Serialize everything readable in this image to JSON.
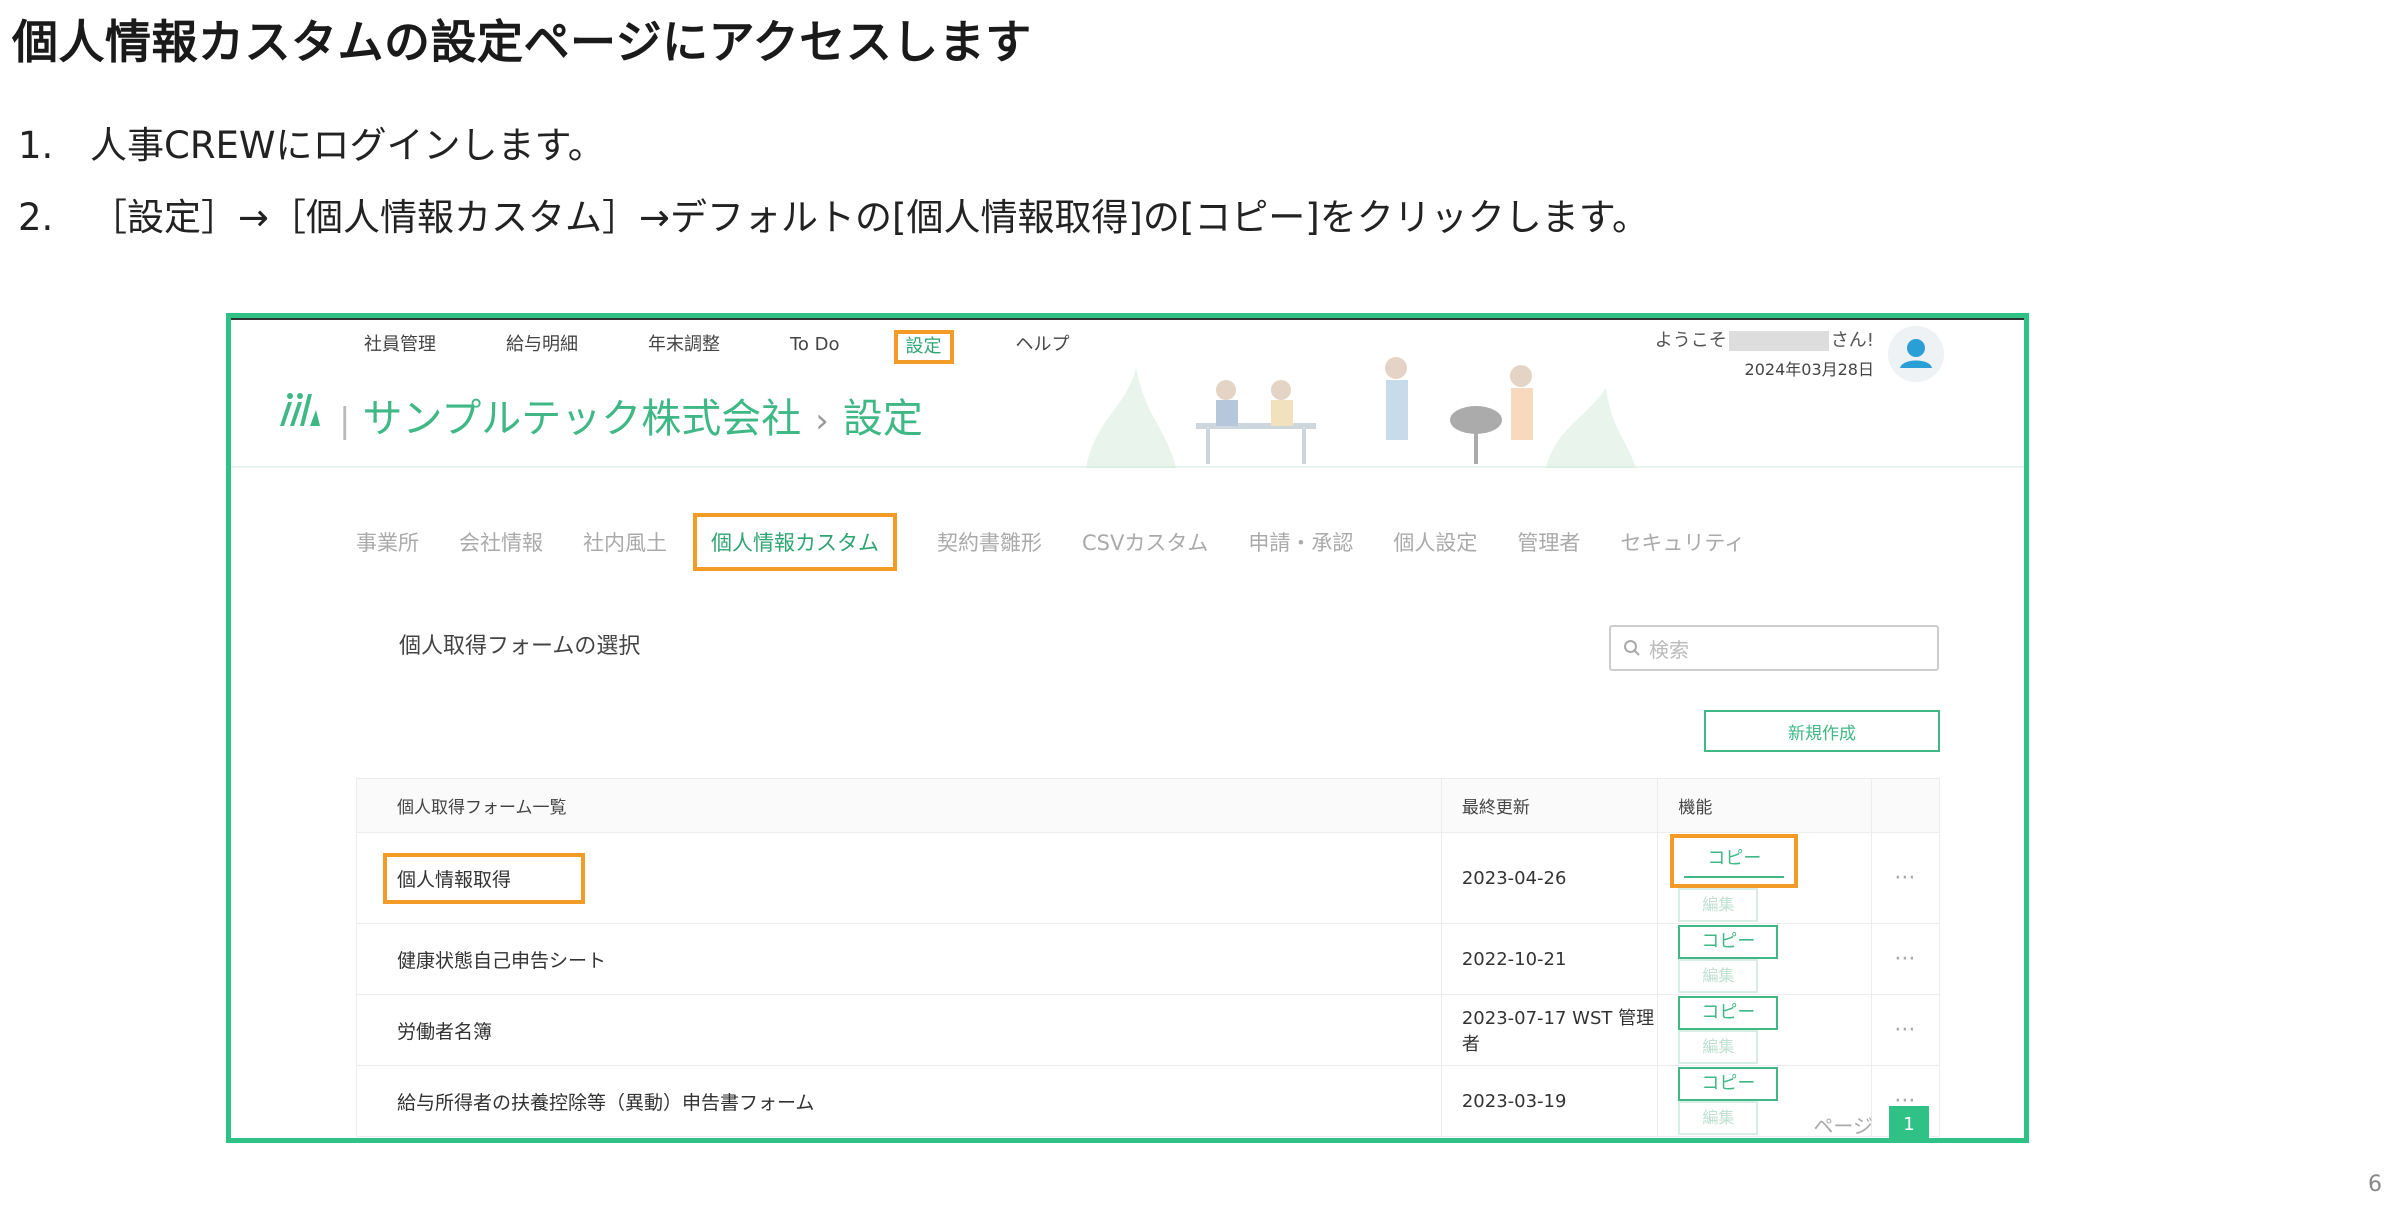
{
  "doc": {
    "title": "個人情報カスタムの設定ページにアクセスします",
    "steps": [
      {
        "num": "1.",
        "text": "人事CREWにログインします。"
      },
      {
        "num": "2.",
        "text": "［設定］→［個人情報カスタム］→デフォルトの[個人情報取得]の[コピー]をクリックします。"
      }
    ],
    "page_number": "6"
  },
  "app": {
    "nav": [
      "社員管理",
      "給与明細",
      "年末調整",
      "To Do",
      "設定",
      "ヘルプ"
    ],
    "nav_active": "設定",
    "company": "サンプルテック株式会社",
    "breadcrumb_sep": "›",
    "page": "設定",
    "greeting_prefix": "ようこそ",
    "greeting_suffix": "さん!",
    "date": "2024年03月28日",
    "tabs": [
      "事業所",
      "会社情報",
      "社内風土",
      "個人情報カスタム",
      "契約書雛形",
      "CSVカスタム",
      "申請・承認",
      "個人設定",
      "管理者",
      "セキュリティ"
    ],
    "tab_active": "個人情報カスタム",
    "section_label": "個人取得フォームの選択",
    "search_placeholder": "検索",
    "new_button": "新規作成",
    "table": {
      "headers": [
        "個人取得フォーム一覧",
        "最終更新",
        "機能"
      ],
      "rows": [
        {
          "name": "個人情報取得",
          "updated": "2023-04-26",
          "copy": "コピー",
          "edit": "編集",
          "more": "···"
        },
        {
          "name": "健康状態自己申告シート",
          "updated": "2022-10-21",
          "copy": "コピー",
          "edit": "編集",
          "more": "···"
        },
        {
          "name": "労働者名簿",
          "updated": "2023-07-17 WST 管理者",
          "copy": "コピー",
          "edit": "編集",
          "more": "···"
        },
        {
          "name": "給与所得者の扶養控除等（異動）申告書フォーム",
          "updated": "2023-03-19",
          "copy": "コピー",
          "edit": "編集",
          "more": "···"
        }
      ]
    },
    "pager_label": "ページ",
    "current_page": "1"
  },
  "colors": {
    "accent": "#2fc186",
    "highlight": "#f39a27",
    "brand_text": "#3fb885"
  }
}
